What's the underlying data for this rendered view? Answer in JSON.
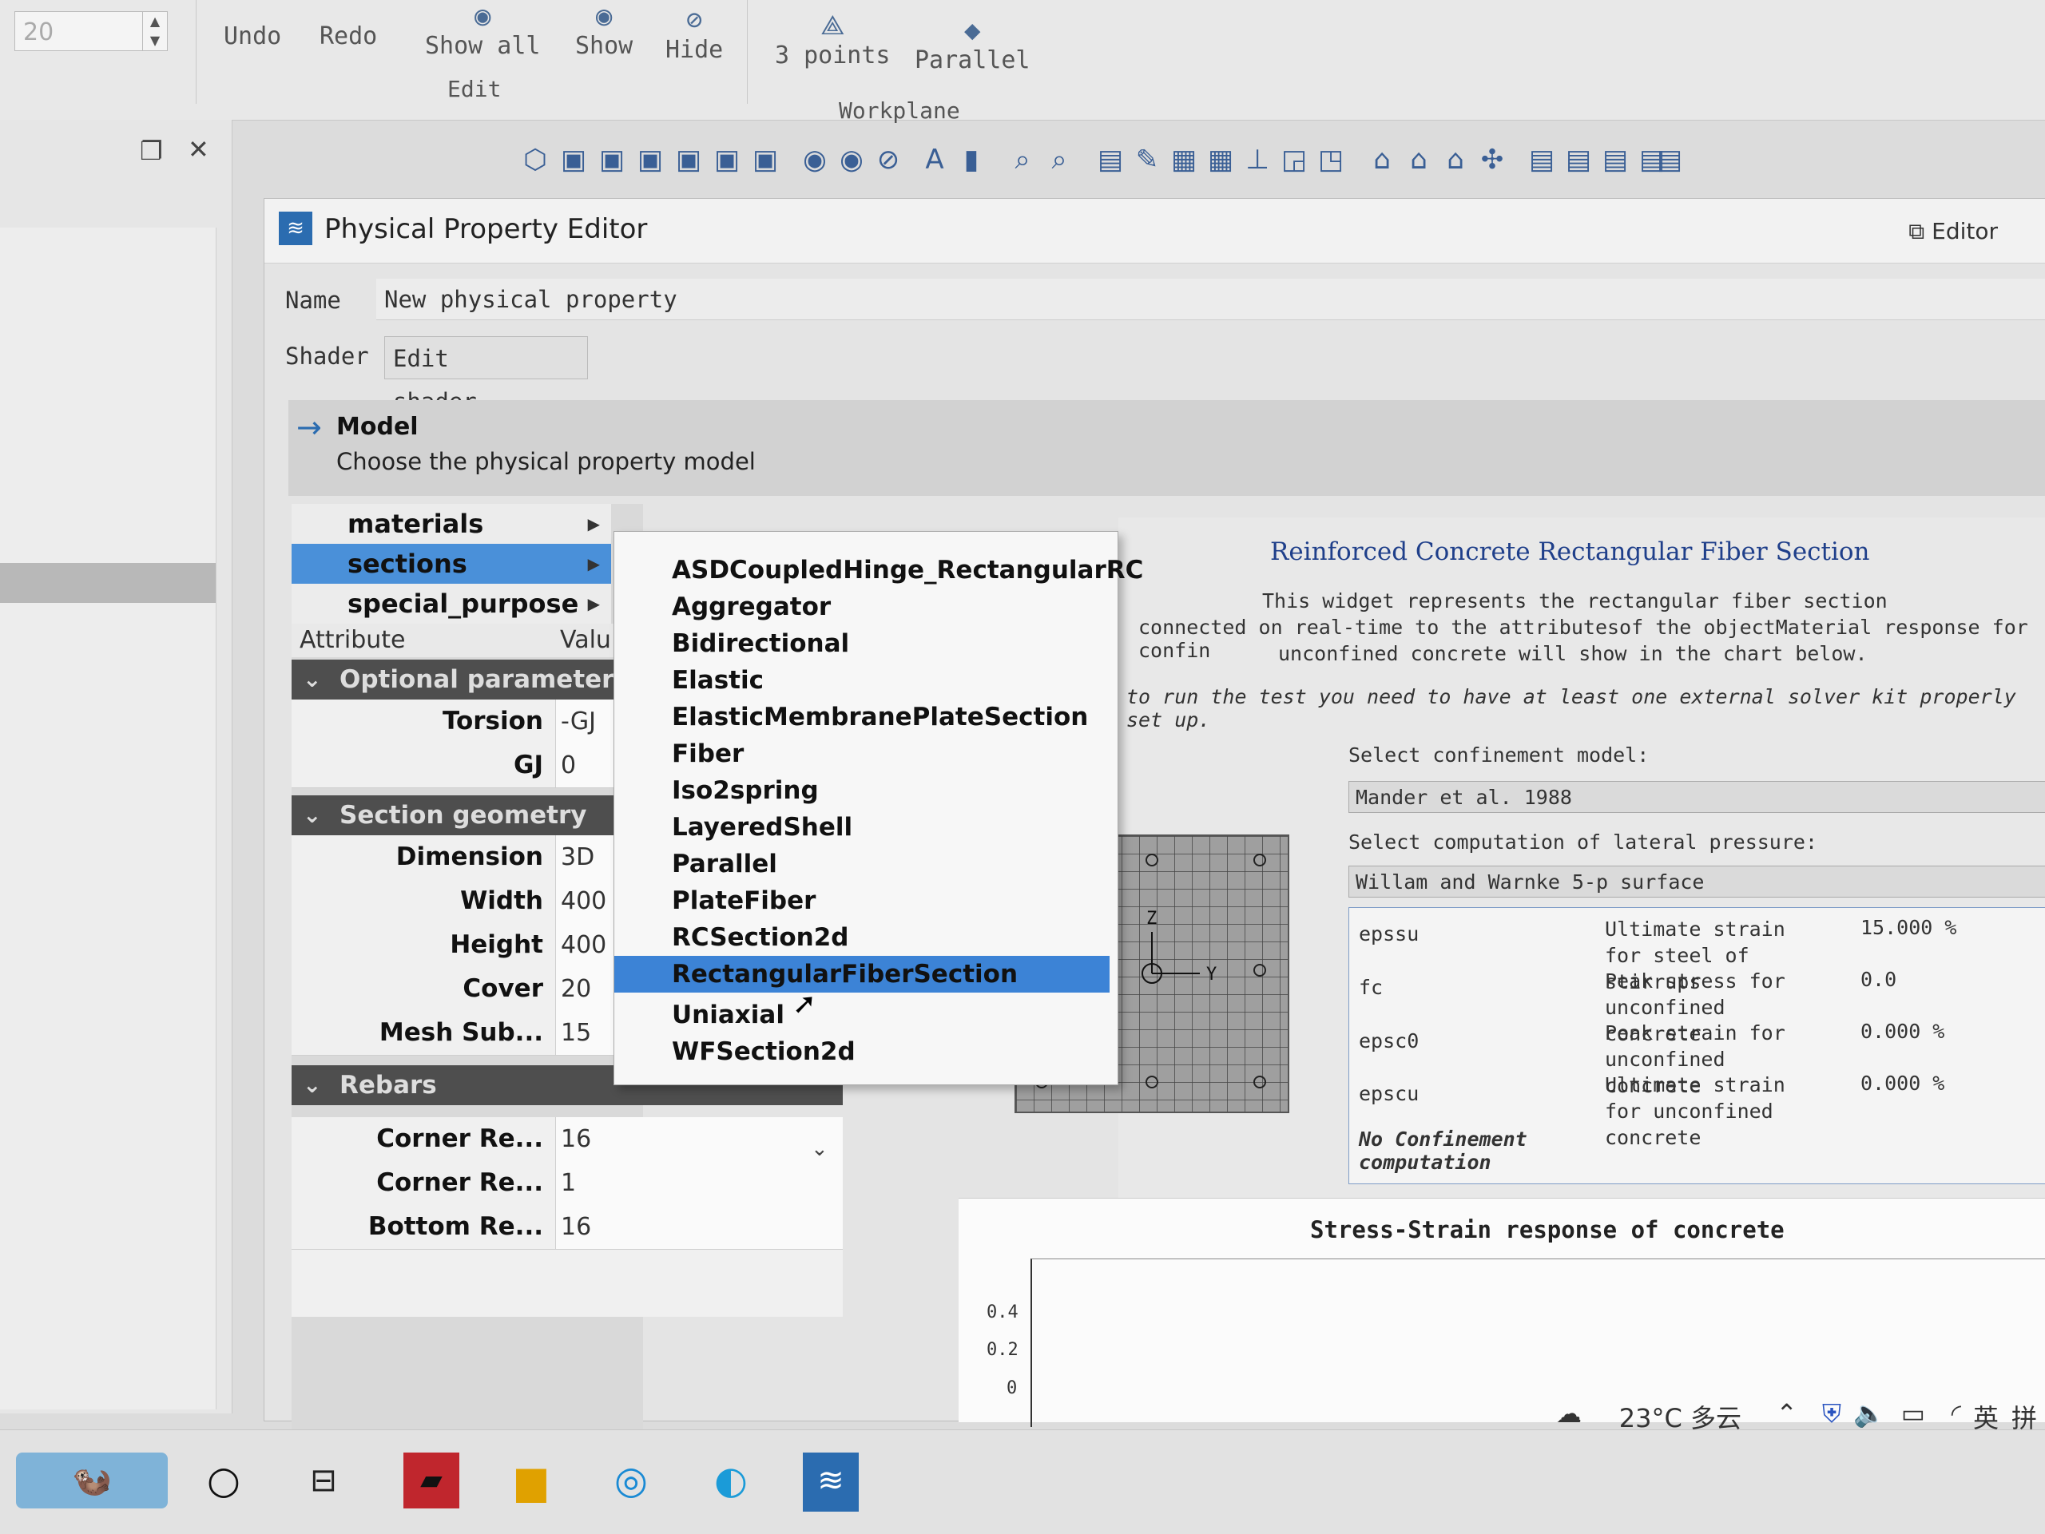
{
  "ribbon": {
    "spin_value": "20",
    "undo": "Undo",
    "redo": "Redo",
    "show_all": "Show all",
    "show": "Show",
    "hide": "Hide",
    "edit_group": "Edit",
    "three_points": "3 points",
    "parallel": "Parallel",
    "workplane_group": "Workplane"
  },
  "dialog": {
    "title": "Physical Property Editor",
    "editor_tab": "Editor",
    "help": "?",
    "name_label": "Name",
    "name_value": "New physical property",
    "shader_label": "Shader",
    "shader_button": "Edit shader...",
    "model_title": "Model",
    "model_subtitle": "Choose the physical property model"
  },
  "menu": {
    "items": [
      {
        "label": "materials"
      },
      {
        "label": "sections"
      },
      {
        "label": "special_purpose"
      }
    ],
    "submenu": [
      "ASDCoupledHinge_RectangularRC",
      "Aggregator",
      "Bidirectional",
      "Elastic",
      "ElasticMembranePlateSection",
      "Fiber",
      "Iso2spring",
      "LayeredShell",
      "Parallel",
      "PlateFiber",
      "RCSection2d",
      "RectangularFiberSection",
      "Uniaxial",
      "WFSection2d"
    ],
    "selected": "RectangularFiberSection"
  },
  "attributes": {
    "col_attribute": "Attribute",
    "col_value": "Valu",
    "optional_title": "Optional parameters",
    "torsion_label": "Torsion",
    "torsion_value": "-GJ",
    "gj_label": "GJ",
    "gj_value": "0",
    "geometry_title": "Section geometry",
    "dimension_label": "Dimension",
    "dimension_value": "3D",
    "width_label": "Width",
    "width_value": "400",
    "height_label": "Height",
    "height_value": "400",
    "cover_label": "Cover",
    "cover_value": "20",
    "mesh_label": "Mesh Sub...",
    "mesh_value": "15",
    "rebars_title": "Rebars",
    "corner1_label": "Corner Re...",
    "corner1_value": "16",
    "corner2_label": "Corner Re...",
    "corner2_value": "1",
    "bottom_label": "Bottom Re...",
    "bottom_value": "16"
  },
  "description": {
    "title": "Reinforced Concrete Rectangular Fiber Section",
    "line1": "This widget represents the rectangular fiber section",
    "line2": "connected on real-time to the attributesof the objectMaterial response for confin",
    "line3": "unconfined concrete will show in the chart below.",
    "line4": "to run the test you need to have at least one external solver kit properly set up.",
    "confinement_label": "Select confinement model:",
    "confinement_value": "Mander et al. 1988",
    "lateral_label": "Select computation of lateral pressure:",
    "lateral_value": "Willam and Warnke 5-p surface"
  },
  "params": [
    {
      "key": "epssu",
      "desc": "Ultimate strain for steel of stirrups",
      "value": "15.000 %"
    },
    {
      "key": "fc",
      "desc": "Peak stress for unconfined concrete",
      "value": "0.0"
    },
    {
      "key": "epsc0",
      "desc": "Peak strain for unconfined concrete",
      "value": "0.000 %"
    },
    {
      "key": "epscu",
      "desc": "Ultimate strain for unconfined concrete",
      "value": "0.000 %"
    }
  ],
  "no_confinement": "No Confinement computation",
  "section_preview": {
    "z_label": "Z",
    "y_label": "Y"
  },
  "chart": {
    "title": "Stress-Strain response of concrete",
    "yticks": [
      "0.4",
      "0.2",
      "0"
    ]
  },
  "tray": {
    "weather": "23°C 多云",
    "ime": "英",
    "ime2": "拼"
  }
}
